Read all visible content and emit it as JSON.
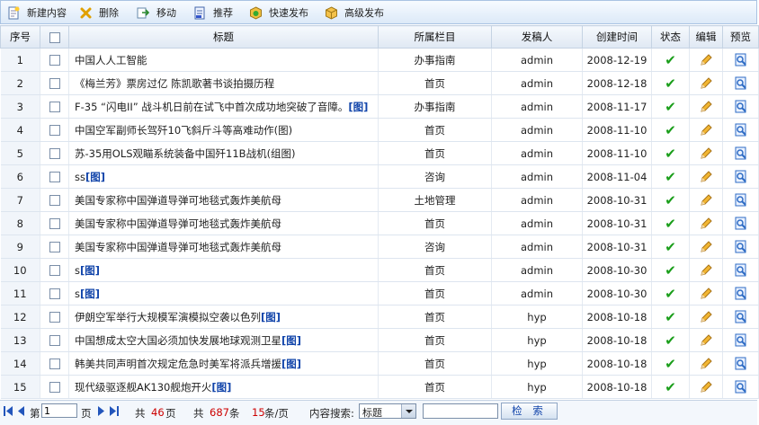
{
  "toolbar": {
    "new": "新建内容",
    "delete": "删除",
    "move": "移动",
    "recommend": "推荐",
    "quick_publish": "快速发布",
    "advanced_publish": "高级发布"
  },
  "table": {
    "headers": {
      "index": "序号",
      "title": "标题",
      "column": "所属栏目",
      "author": "发稿人",
      "created": "创建时间",
      "status": "状态",
      "edit": "编辑",
      "preview": "预览"
    },
    "status_icon": "check-icon",
    "edit_icon": "pencil-icon",
    "preview_icon": "preview-icon",
    "rows": [
      {
        "index": "1",
        "title": "中国人人工智能",
        "tag": "",
        "column": "办事指南",
        "author": "admin",
        "date": "2008-12-19"
      },
      {
        "index": "2",
        "title": "《梅兰芳》票房过亿 陈凯歌著书谈拍摄历程",
        "tag": "",
        "column": "首页",
        "author": "admin",
        "date": "2008-12-18"
      },
      {
        "index": "3",
        "title": "F-35 “闪电II” 战斗机日前在试飞中首次成功地突破了音障。",
        "tag": "[图]",
        "column": "办事指南",
        "author": "admin",
        "date": "2008-11-17"
      },
      {
        "index": "4",
        "title": "中国空军副师长驾歼10飞斜斤斗等高难动作(图)",
        "tag": "",
        "column": "首页",
        "author": "admin",
        "date": "2008-11-10"
      },
      {
        "index": "5",
        "title": "苏-35用OLS观瞄系统装备中国歼11B战机(组图)",
        "tag": "",
        "column": "首页",
        "author": "admin",
        "date": "2008-11-10"
      },
      {
        "index": "6",
        "title": "ss",
        "tag": "[图]",
        "column": "咨询",
        "author": "admin",
        "date": "2008-11-04"
      },
      {
        "index": "7",
        "title": "美国专家称中国弹道导弹可地毯式轰炸美航母",
        "tag": "",
        "column": "土地管理",
        "author": "admin",
        "date": "2008-10-31"
      },
      {
        "index": "8",
        "title": "美国专家称中国弹道导弹可地毯式轰炸美航母",
        "tag": "",
        "column": "首页",
        "author": "admin",
        "date": "2008-10-31"
      },
      {
        "index": "9",
        "title": "美国专家称中国弹道导弹可地毯式轰炸美航母",
        "tag": "",
        "column": "咨询",
        "author": "admin",
        "date": "2008-10-31"
      },
      {
        "index": "10",
        "title": "s",
        "tag": "[图]",
        "column": "首页",
        "author": "admin",
        "date": "2008-10-30"
      },
      {
        "index": "11",
        "title": "s",
        "tag": "[图]",
        "column": "首页",
        "author": "admin",
        "date": "2008-10-30"
      },
      {
        "index": "12",
        "title": "伊朗空军举行大规模军演模拟空袭以色列",
        "tag": "[图]",
        "column": "首页",
        "author": "hyp",
        "date": "2008-10-18"
      },
      {
        "index": "13",
        "title": "中国想成太空大国必须加快发展地球观测卫星",
        "tag": "[图]",
        "column": "首页",
        "author": "hyp",
        "date": "2008-10-18"
      },
      {
        "index": "14",
        "title": "韩美共同声明首次规定危急时美军将派兵增援",
        "tag": "[图]",
        "column": "首页",
        "author": "hyp",
        "date": "2008-10-18"
      },
      {
        "index": "15",
        "title": "现代级驱逐舰AK130舰炮开火",
        "tag": "[图]",
        "column": "首页",
        "author": "hyp",
        "date": "2008-10-18"
      }
    ]
  },
  "pagination": {
    "page_prefix": "第",
    "current_page": "1",
    "page_suffix": "页",
    "total_label": "共",
    "total_pages": "46",
    "pages_unit": "页",
    "total_label2": "共",
    "total_items": "687",
    "items_unit": "条",
    "per_page": "15",
    "per_page_unit": "条/页",
    "search_label": "内容搜索:",
    "search_field": "标题",
    "search_button": "检 索"
  },
  "colors": {
    "accent": "#1144aa",
    "count_red": "#cc0000",
    "check_green": "#1a9e1a"
  }
}
